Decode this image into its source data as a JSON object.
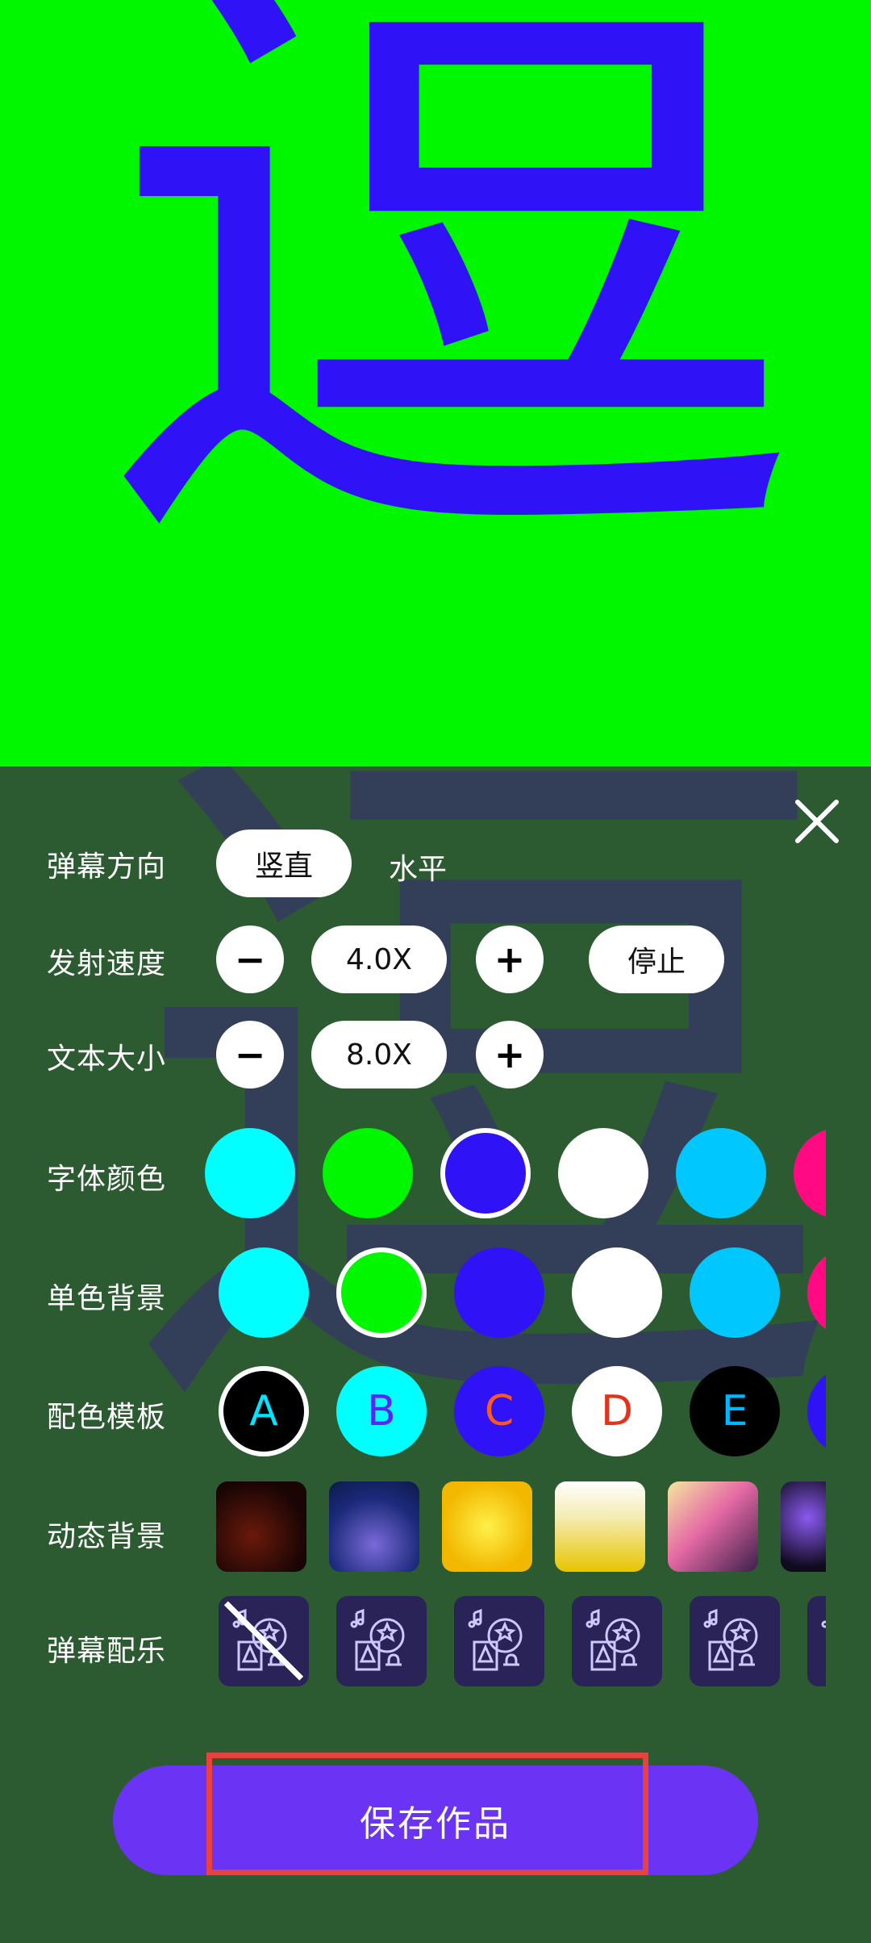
{
  "preview": {
    "glyph": "逗"
  },
  "settings": {
    "direction": {
      "label": "弹幕方向",
      "options": [
        "竖直",
        "水平"
      ],
      "selected": "竖直"
    },
    "speed": {
      "label": "发射速度",
      "value": "4.0X",
      "stop_label": "停止"
    },
    "text_size": {
      "label": "文本大小",
      "value": "8.0X"
    },
    "font_color": {
      "label": "字体颜色",
      "colors": [
        "#00ffff",
        "#00f700",
        "#2f12f6",
        "#ffffff",
        "#00c8ff",
        "#ff0a82"
      ],
      "selected_index": 2
    },
    "solid_bg": {
      "label": "单色背景",
      "colors": [
        "#00ffff",
        "#00f700",
        "#2f12f6",
        "#ffffff",
        "#00c8ff",
        "#ff0a82"
      ],
      "selected_index": 1
    },
    "color_template": {
      "label": "配色模板",
      "items": [
        {
          "letter": "A",
          "bg": "#000000",
          "fg": "#00e5ff",
          "selected": true
        },
        {
          "letter": "B",
          "bg": "#00ffff",
          "fg": "#5b25f5",
          "selected": false
        },
        {
          "letter": "C",
          "bg": "#2f12f6",
          "fg": "#ff5a1a",
          "selected": false
        },
        {
          "letter": "D",
          "bg": "#ffffff",
          "fg": "#e4331c",
          "selected": false
        },
        {
          "letter": "E",
          "bg": "#000000",
          "fg": "#00b7ff",
          "selected": false
        },
        {
          "letter": "",
          "bg": "#2f12f6",
          "fg": "#ffffff",
          "selected": false
        }
      ]
    },
    "dynamic_bg": {
      "label": "动态背景"
    },
    "music": {
      "label": "弹幕配乐"
    }
  },
  "save_button": {
    "label": "保存作品"
  },
  "icons": [
    "close-icon",
    "minus-icon",
    "plus-icon",
    "music-note-icon"
  ]
}
